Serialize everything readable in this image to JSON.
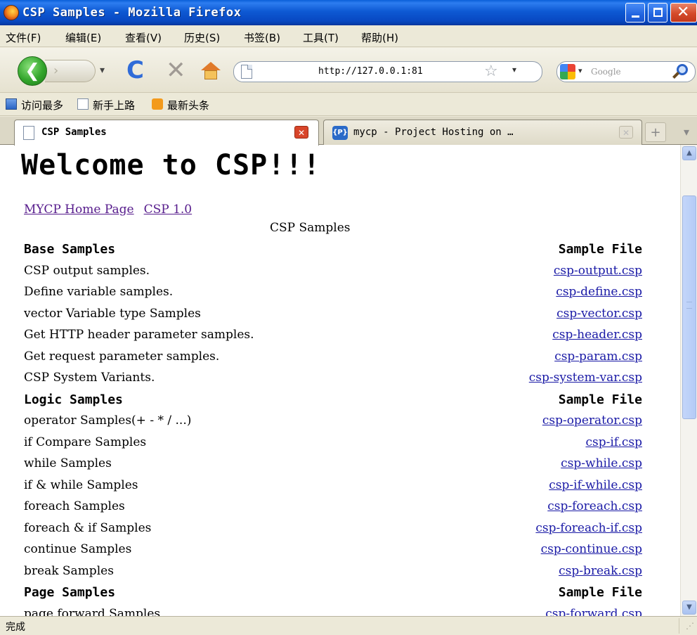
{
  "window": {
    "title": "CSP Samples - Mozilla Firefox",
    "minimize_glyph": "",
    "close_glyph": "✕"
  },
  "menu": [
    "文件(F)",
    "编辑(E)",
    "查看(V)",
    "历史(S)",
    "书签(B)",
    "工具(T)",
    "帮助(H)"
  ],
  "nav": {
    "back_glyph": "❮",
    "forward_glyph": "›",
    "history_glyph": "▾",
    "reload_glyph": "C",
    "stop_glyph": "✕",
    "url": "http://127.0.0.1:81",
    "star_glyph": "☆",
    "url_drop_glyph": "▾",
    "search_placeholder": "Google",
    "engine_drop_glyph": "▾"
  },
  "bookmarks": [
    "访问最多",
    "新手上路",
    "最新头条"
  ],
  "tabs": [
    {
      "label": "CSP Samples",
      "active": true,
      "close_glyph": "✕"
    },
    {
      "label": "mycp - Project Hosting on …",
      "active": false,
      "icon_text": "{P}",
      "close_glyph": "✕"
    }
  ],
  "tabstrip": {
    "newtab_glyph": "+",
    "list_glyph": "▾"
  },
  "page": {
    "heading": "Welcome to CSP!!!",
    "links": [
      "MYCP Home Page",
      "CSP 1.0"
    ],
    "caption": "CSP Samples",
    "rows": [
      {
        "type": "header",
        "label": "Base Samples",
        "file": "Sample File"
      },
      {
        "label": "CSP output samples.",
        "file": "csp-output.csp"
      },
      {
        "label": "Define variable samples.",
        "file": "csp-define.csp"
      },
      {
        "label": "vector Variable type Samples",
        "file": "csp-vector.csp"
      },
      {
        "label": "Get HTTP header parameter samples.",
        "file": "csp-header.csp"
      },
      {
        "label": "Get request parameter samples.",
        "file": "csp-param.csp"
      },
      {
        "label": "CSP System Variants.",
        "file": "csp-system-var.csp"
      },
      {
        "type": "header",
        "label": "Logic Samples",
        "file": "Sample File"
      },
      {
        "label": "operator Samples(+ - * / ...)",
        "file": "csp-operator.csp"
      },
      {
        "label": "if Compare Samples",
        "file": "csp-if.csp"
      },
      {
        "label": "while Samples",
        "file": "csp-while.csp"
      },
      {
        "label": "if & while Samples",
        "file": "csp-if-while.csp"
      },
      {
        "label": "foreach Samples",
        "file": "csp-foreach.csp"
      },
      {
        "label": "foreach & if Samples",
        "file": "csp-foreach-if.csp"
      },
      {
        "label": "continue Samples",
        "file": "csp-continue.csp"
      },
      {
        "label": "break Samples",
        "file": "csp-break.csp"
      },
      {
        "type": "header",
        "label": "Page Samples",
        "file": "Sample File"
      },
      {
        "label": "page forward Samples",
        "file": "csp-forward.csp"
      }
    ]
  },
  "scrollbar": {
    "up_glyph": "▲",
    "down_glyph": "▼"
  },
  "status": {
    "text": "完成",
    "grip_glyph": "⋰"
  }
}
